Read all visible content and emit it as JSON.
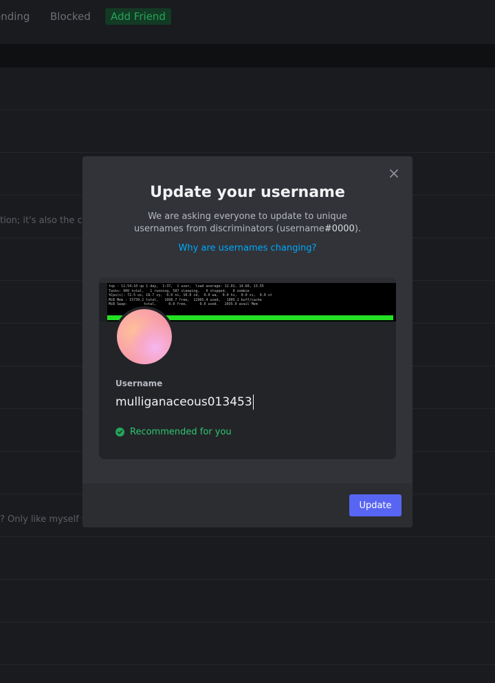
{
  "background": {
    "tabs": {
      "pending": "ending",
      "blocked": "Blocked",
      "add_friend": "Add Friend"
    },
    "snippets": [
      "tion; it's also the ca",
      "? Only like myself wh"
    ]
  },
  "modal": {
    "title": "Update your username",
    "description_pre": "We are asking everyone to update to unique usernames from discriminators (username",
    "description_bold": "#0000",
    "description_post": ").",
    "why_link": "Why are usernames changing?",
    "banner_terminal": "top - 11:54:10 up 1 day,  1:37,  1 user,  load average: 12.01, 14.60, 13.55\nTasks: 900 total,   1 running, 587 sleeping,   0 stopped,   0 zombie\n%Cpu(s): 72.5 us, 18.7 sy,  0.0 ni, 10.0 id,  0.0 wa,  0.0 hi,  0.0 si,  0.0 st\nMiB Mem : 15739.2 total,   1608.7 free,  12965.4 used,   1005.1 buff/cache\nMiB Swap:        total,      0.0 free,      0.0 used.   2035.0 avail Mem",
    "username_label": "Username",
    "username_value": "mulliganaceous013453",
    "recommended": "Recommended for you",
    "update_button": "Update"
  },
  "colors": {
    "accent": "#5865f2",
    "link": "#00a8fc",
    "success": "#23a55a"
  }
}
